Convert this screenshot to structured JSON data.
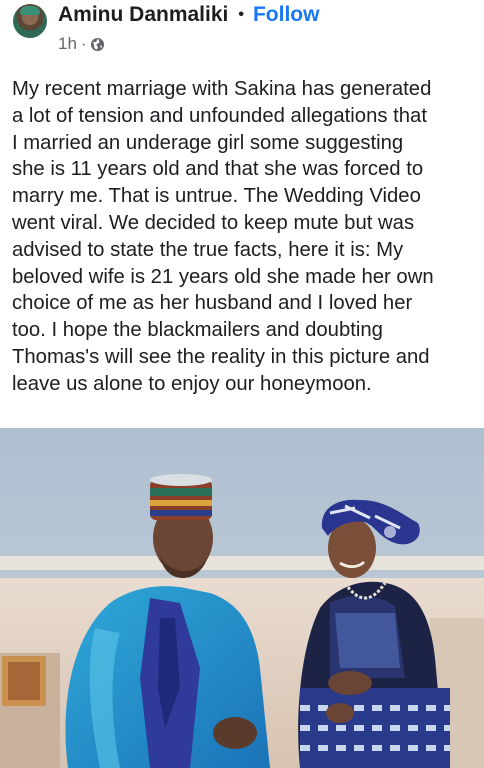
{
  "post": {
    "author_name": "Aminu Danmaliki",
    "separator": "•",
    "follow_label": "Follow",
    "time": "1h",
    "time_separator": "·",
    "privacy_icon": "globe-icon",
    "text": "My recent marriage with Sakina has generated\na lot of tension and unfounded allegations that\nI married an underage girl some suggesting\nshe is 11 years old and that she was forced to\nmarry me. That is untrue. The Wedding Video\nwent viral. We decided to keep mute but was\nadvised to state the true facts, here it is: My\nbeloved wife is 21 years old she made her own\nchoice of me as her husband and I loved her\ntoo. I hope the blackmailers and doubting\nThomas's will see the reality in this picture and\nleave us alone to enjoy our honeymoon."
  },
  "colors": {
    "link": "#1877f2",
    "text": "#1c1e21",
    "meta": "#65676b"
  }
}
